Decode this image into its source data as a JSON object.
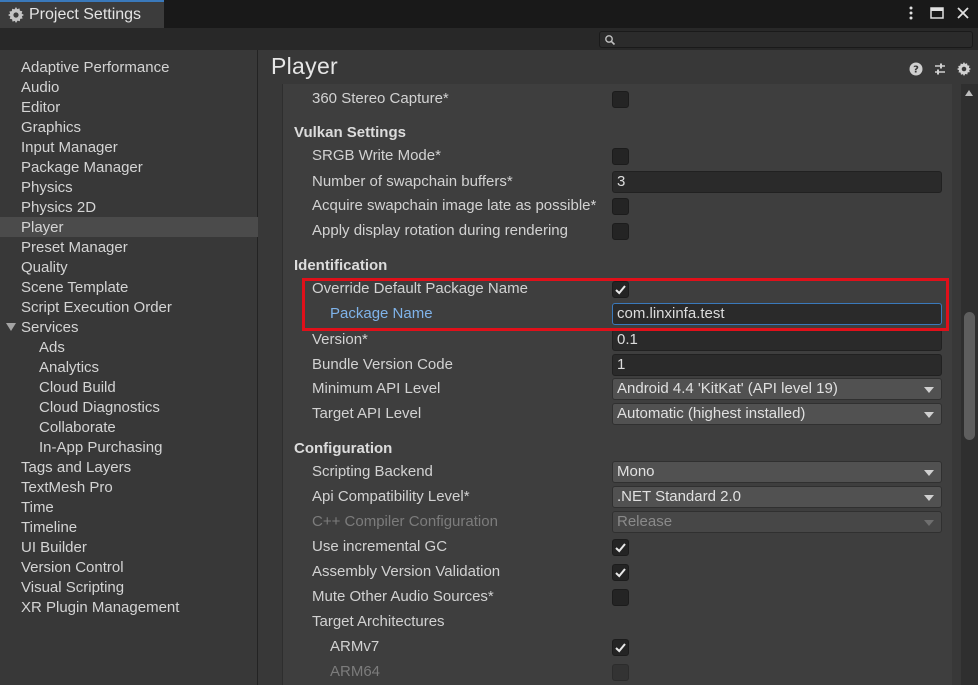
{
  "window": {
    "tab_title": "Project Settings",
    "search_placeholder": ""
  },
  "sidebar": {
    "items": [
      {
        "label": "Adaptive Performance"
      },
      {
        "label": "Audio"
      },
      {
        "label": "Editor"
      },
      {
        "label": "Graphics"
      },
      {
        "label": "Input Manager"
      },
      {
        "label": "Package Manager"
      },
      {
        "label": "Physics"
      },
      {
        "label": "Physics 2D"
      },
      {
        "label": "Player",
        "selected": true
      },
      {
        "label": "Preset Manager"
      },
      {
        "label": "Quality"
      },
      {
        "label": "Scene Template"
      },
      {
        "label": "Script Execution Order"
      },
      {
        "label": "Services",
        "expanded": true
      },
      {
        "label": "Ads",
        "sub": true
      },
      {
        "label": "Analytics",
        "sub": true
      },
      {
        "label": "Cloud Build",
        "sub": true
      },
      {
        "label": "Cloud Diagnostics",
        "sub": true
      },
      {
        "label": "Collaborate",
        "sub": true
      },
      {
        "label": "In-App Purchasing",
        "sub": true
      },
      {
        "label": "Tags and Layers"
      },
      {
        "label": "TextMesh Pro"
      },
      {
        "label": "Time"
      },
      {
        "label": "Timeline"
      },
      {
        "label": "UI Builder"
      },
      {
        "label": "Version Control"
      },
      {
        "label": "Visual Scripting"
      },
      {
        "label": "XR Plugin Management"
      }
    ]
  },
  "main": {
    "title": "Player",
    "stereo": {
      "label": "360 Stereo Capture*",
      "checked": false
    },
    "vulkan": {
      "heading": "Vulkan Settings",
      "srgb": {
        "label": "SRGB Write Mode*",
        "checked": false
      },
      "swapchain": {
        "label": "Number of swapchain buffers*",
        "value": "3"
      },
      "acquire": {
        "label": "Acquire swapchain image late as possible*",
        "checked": false
      },
      "rotation": {
        "label": "Apply display rotation during rendering",
        "checked": false
      }
    },
    "identification": {
      "heading": "Identification",
      "override": {
        "label": "Override Default Package Name",
        "checked": true
      },
      "package_name": {
        "label": "Package Name",
        "value": "com.linxinfa.test"
      },
      "version": {
        "label": "Version*",
        "value": "0.1"
      },
      "bundle_code": {
        "label": "Bundle Version Code",
        "value": "1"
      },
      "min_api": {
        "label": "Minimum API Level",
        "value": "Android 4.4 'KitKat' (API level 19)"
      },
      "target_api": {
        "label": "Target API Level",
        "value": "Automatic (highest installed)"
      }
    },
    "configuration": {
      "heading": "Configuration",
      "scripting_backend": {
        "label": "Scripting Backend",
        "value": "Mono"
      },
      "api_compat": {
        "label": "Api Compatibility Level*",
        "value": ".NET Standard 2.0"
      },
      "cpp_config": {
        "label": "C++ Compiler Configuration",
        "value": "Release"
      },
      "incremental_gc": {
        "label": "Use incremental GC",
        "checked": true
      },
      "assembly_validation": {
        "label": "Assembly Version Validation",
        "checked": true
      },
      "mute_audio": {
        "label": "Mute Other Audio Sources*",
        "checked": false
      },
      "target_arch": {
        "label": "Target Architectures"
      },
      "armv7": {
        "label": "ARMv7",
        "checked": true
      },
      "arm64": {
        "label": "ARM64",
        "checked": false
      }
    }
  },
  "colors": {
    "accent": "#3a79bb",
    "highlight": "#e0101a",
    "link": "#7fb3ea"
  }
}
